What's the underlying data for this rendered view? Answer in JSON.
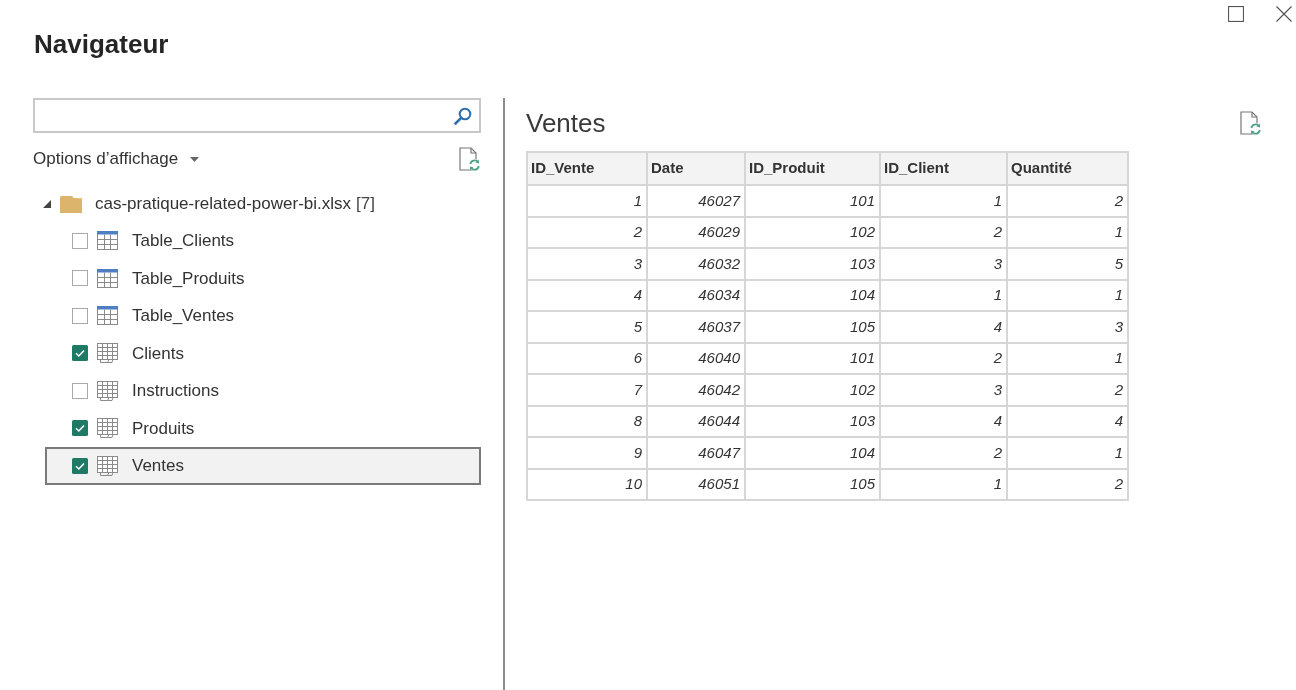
{
  "window": {
    "title": "Navigateur"
  },
  "display_options": {
    "label": "Options d’affichage"
  },
  "tree": {
    "name": "cas-pratique-related-power-bi.xlsx",
    "count": "[7]",
    "expanded": true,
    "children": [
      {
        "label": "Table_Clients",
        "kind": "table",
        "checked": false,
        "selected": false
      },
      {
        "label": "Table_Produits",
        "kind": "table",
        "checked": false,
        "selected": false
      },
      {
        "label": "Table_Ventes",
        "kind": "table",
        "checked": false,
        "selected": false
      },
      {
        "label": "Clients",
        "kind": "sheet",
        "checked": true,
        "selected": false
      },
      {
        "label": "Instructions",
        "kind": "sheet",
        "checked": false,
        "selected": false
      },
      {
        "label": "Produits",
        "kind": "sheet",
        "checked": true,
        "selected": false
      },
      {
        "label": "Ventes",
        "kind": "sheet",
        "checked": true,
        "selected": true
      }
    ]
  },
  "preview": {
    "title": "Ventes",
    "table": {
      "columns": [
        "ID_Vente",
        "Date",
        "ID_Produit",
        "ID_Client",
        "Quantité"
      ],
      "rows": [
        [
          "1",
          "46027",
          "101",
          "1",
          "2"
        ],
        [
          "2",
          "46029",
          "102",
          "2",
          "1"
        ],
        [
          "3",
          "46032",
          "103",
          "3",
          "5"
        ],
        [
          "4",
          "46034",
          "104",
          "1",
          "1"
        ],
        [
          "5",
          "46037",
          "105",
          "4",
          "3"
        ],
        [
          "6",
          "46040",
          "101",
          "2",
          "1"
        ],
        [
          "7",
          "46042",
          "102",
          "3",
          "2"
        ],
        [
          "8",
          "46044",
          "103",
          "4",
          "4"
        ],
        [
          "9",
          "46047",
          "104",
          "2",
          "1"
        ],
        [
          "10",
          "46051",
          "105",
          "1",
          "2"
        ]
      ]
    }
  }
}
